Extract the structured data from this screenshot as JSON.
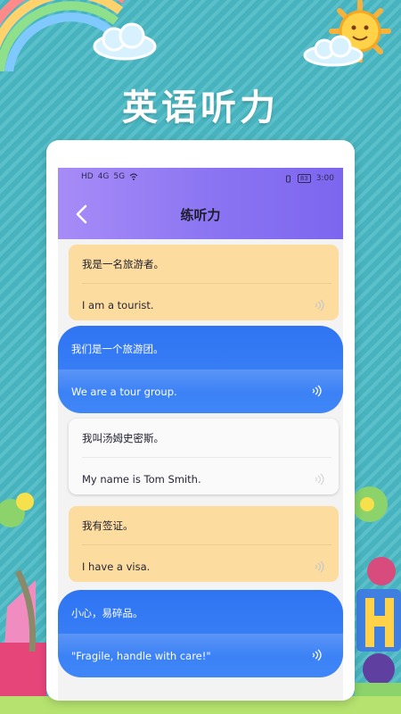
{
  "promo": {
    "title": "英语听力"
  },
  "status_bar": {
    "left": [
      "HD",
      "4G",
      "5G",
      "wifi",
      "vibrate"
    ],
    "battery": "83",
    "time": "3:00"
  },
  "header": {
    "title": "练听力"
  },
  "sentences": [
    {
      "cn": "我是一名旅游者。",
      "en": "I am a tourist.",
      "style": "beige"
    },
    {
      "cn": "我们是一个旅游团。",
      "en": "We are a tour group.",
      "style": "blue"
    },
    {
      "cn": "我叫汤姆史密斯。",
      "en": "My name is Tom Smith.",
      "style": "white"
    },
    {
      "cn": "我有签证。",
      "en": "I have a visa.",
      "style": "beige"
    },
    {
      "cn": "小心，易碎品。",
      "en": "\"Fragile, handle with care!\"",
      "style": "blue"
    }
  ],
  "icons": {
    "back": "chevron-left-icon",
    "speaker": "speaker-icon"
  },
  "colors": {
    "header_start": "#a78cf7",
    "header_end": "#7c66ef",
    "beige_card": "#fddca0",
    "blue_card": "#2f74f2",
    "background": "#49b9c4"
  }
}
